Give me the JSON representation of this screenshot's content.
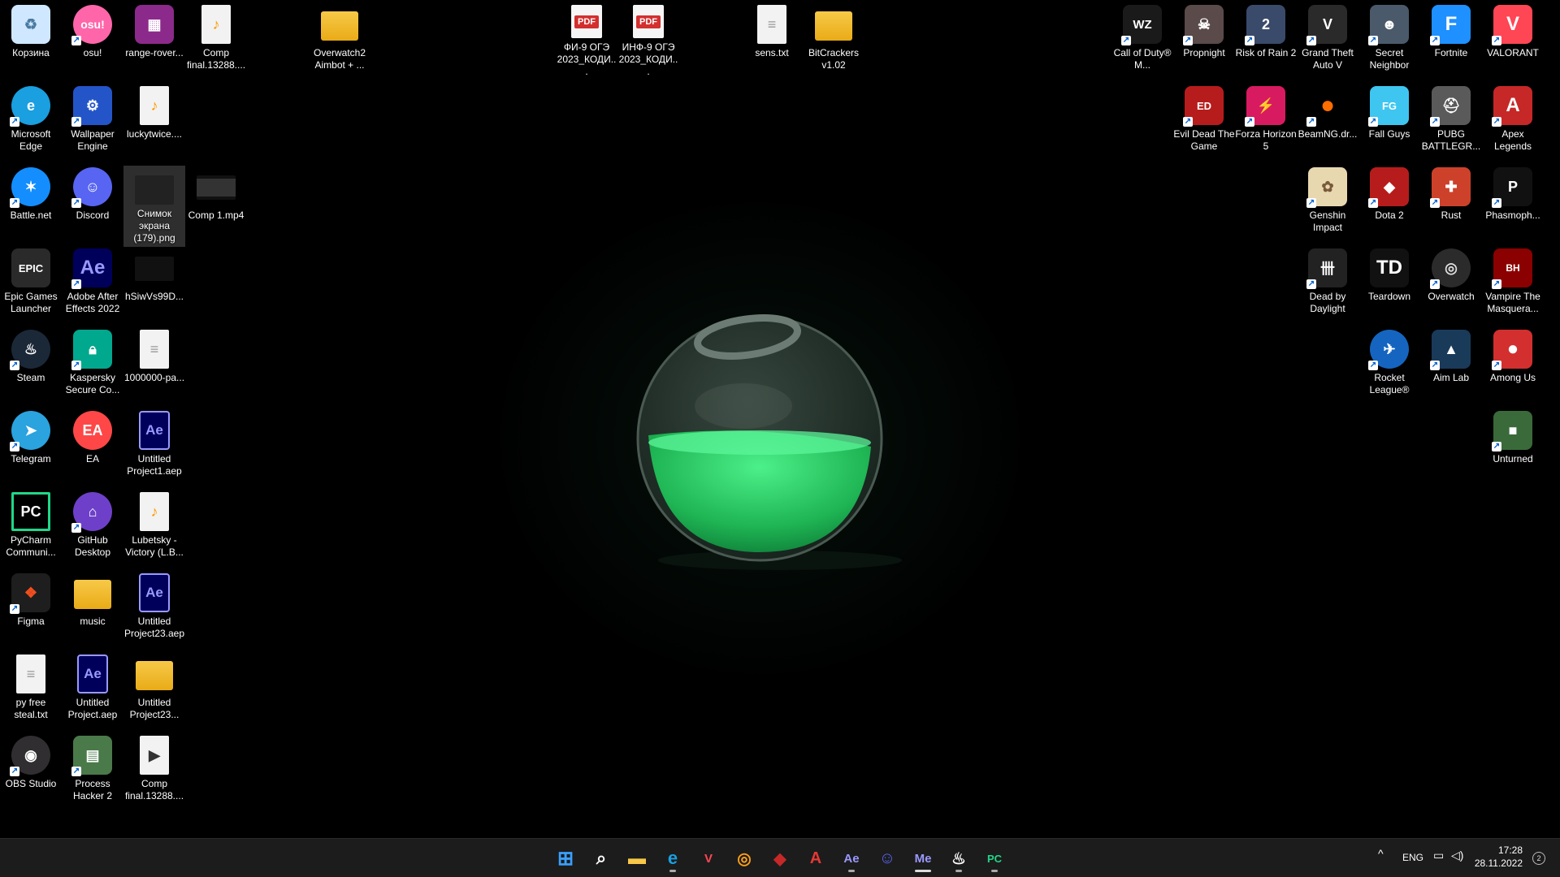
{
  "desktop_icons": {
    "korzina": {
      "label": "Корзина",
      "icon": "recycle-bin-icon",
      "color": "#cfe8ff"
    },
    "osu": {
      "label": "osu!",
      "icon": "osu-icon",
      "color": "#ff66aa"
    },
    "range_rover": {
      "label": "range-rover...",
      "icon": "winrar-archive-icon",
      "color": "#8b2a8b"
    },
    "comp_final_top": {
      "label": "Comp final.13288....",
      "icon": "audio-file-icon",
      "color": "#ffffff"
    },
    "overwatch2_aimbot": {
      "label": "Overwatch2 Aimbot + ...",
      "icon": "folder-icon"
    },
    "fi9": {
      "label": "ФИ-9 ОГЭ 2023_КОДИ...",
      "icon": "pdf-file-icon"
    },
    "inf9": {
      "label": "ИНФ-9 ОГЭ 2023_КОДИ...",
      "icon": "pdf-file-icon"
    },
    "sens": {
      "label": "sens.txt",
      "icon": "text-file-icon"
    },
    "bitcrackers": {
      "label": "BitCrackers v1.02",
      "icon": "folder-icon"
    },
    "edge": {
      "label": "Microsoft Edge",
      "icon": "edge-icon",
      "color": "#1a9fe0"
    },
    "wallpaper_engine": {
      "label": "Wallpaper Engine",
      "icon": "wallpaper-engine-icon",
      "color": "#2455c8"
    },
    "luckytwice": {
      "label": "luckytwice....",
      "icon": "audio-file-icon"
    },
    "battlenet": {
      "label": "Battle.net",
      "icon": "battlenet-icon",
      "color": "#148eff"
    },
    "discord": {
      "label": "Discord",
      "icon": "discord-icon",
      "color": "#5865f2"
    },
    "snimok": {
      "label": "Снимок экрана (179).png",
      "icon": "image-file-icon"
    },
    "comp1": {
      "label": "Comp 1.mp4",
      "icon": "video-file-icon"
    },
    "epic": {
      "label": "Epic Games Launcher",
      "icon": "epic-games-icon",
      "color": "#2a2a2a"
    },
    "after_effects": {
      "label": "Adobe After Effects 2022",
      "icon": "after-effects-icon",
      "color": "#00005b"
    },
    "hsiw": {
      "label": "hSiwVs99D...",
      "icon": "image-file-icon"
    },
    "steam": {
      "label": "Steam",
      "icon": "steam-icon",
      "color": "#1b2838"
    },
    "kaspersky": {
      "label": "Kaspersky Secure Co...",
      "icon": "kaspersky-icon",
      "color": "#00a88e"
    },
    "pa1000000": {
      "label": "1000000-pa...",
      "icon": "text-file-icon"
    },
    "telegram": {
      "label": "Telegram",
      "icon": "telegram-icon",
      "color": "#2aa3df"
    },
    "ea": {
      "label": "EA",
      "icon": "ea-icon",
      "color": "#ff4747"
    },
    "untitled1": {
      "label": "Untitled Project1.aep",
      "icon": "aep-file-icon"
    },
    "pycharm": {
      "label": "PyCharm Communi...",
      "icon": "pycharm-icon",
      "color": "#21d789"
    },
    "github": {
      "label": "GitHub Desktop",
      "icon": "github-icon",
      "color": "#6e40c9"
    },
    "lubetsky": {
      "label": "Lubetsky - Victory (L.B...",
      "icon": "audio-file-icon"
    },
    "figma": {
      "label": "Figma",
      "icon": "figma-icon",
      "color": "#1e1e1e"
    },
    "music": {
      "label": "music",
      "icon": "folder-icon"
    },
    "untitled23": {
      "label": "Untitled Project23.aep",
      "icon": "aep-file-icon"
    },
    "py_free": {
      "label": "py free steal.txt",
      "icon": "text-file-icon"
    },
    "untitled": {
      "label": "Untitled Project.aep",
      "icon": "aep-file-icon"
    },
    "untitled23_folder": {
      "label": "Untitled Project23...",
      "icon": "folder-icon"
    },
    "obs": {
      "label": "OBS Studio",
      "icon": "obs-icon",
      "color": "#302e31"
    },
    "process_hacker": {
      "label": "Process Hacker 2",
      "icon": "process-hacker-icon",
      "color": "#4a7a4a"
    },
    "comp_final_bottom": {
      "label": "Comp final.13288....",
      "icon": "media-file-icon"
    },
    "cod": {
      "label": "Call of Duty® M...",
      "icon": "warzone-icon",
      "color": "#1a1a1a"
    },
    "propnight": {
      "label": "Propnight",
      "icon": "propnight-icon",
      "color": "#5a4a4a"
    },
    "ror2": {
      "label": "Risk of Rain 2",
      "icon": "risk-of-rain-icon",
      "color": "#3a4a6a"
    },
    "gta": {
      "label": "Grand Theft Auto V",
      "icon": "gta-icon",
      "color": "#2a2a2a"
    },
    "secret_neighbor": {
      "label": "Secret Neighbor",
      "icon": "secret-neighbor-icon",
      "color": "#4a5a6a"
    },
    "fortnite": {
      "label": "Fortnite",
      "icon": "fortnite-icon",
      "color": "#1e90ff"
    },
    "valorant": {
      "label": "VALORANT",
      "icon": "valorant-icon",
      "color": "#ff4655"
    },
    "evil_dead": {
      "label": "Evil Dead The Game",
      "icon": "evil-dead-icon",
      "color": "#b71c1c"
    },
    "forza": {
      "label": "Forza Horizon 5",
      "icon": "forza-icon",
      "color": "#d81b60"
    },
    "beamng": {
      "label": "BeamNG.dr...",
      "icon": "beamng-icon",
      "color": "#ff6d00"
    },
    "fall_guys": {
      "label": "Fall Guys",
      "icon": "fall-guys-icon",
      "color": "#3ec6f0"
    },
    "pubg": {
      "label": "PUBG BATTLEGR...",
      "icon": "pubg-icon",
      "color": "#5a5a5a"
    },
    "apex": {
      "label": "Apex Legends",
      "icon": "apex-icon",
      "color": "#c62828"
    },
    "genshin": {
      "label": "Genshin Impact",
      "icon": "genshin-icon",
      "color": "#e8d8b0"
    },
    "dota2": {
      "label": "Dota 2",
      "icon": "dota-icon",
      "color": "#b71c1c"
    },
    "rust": {
      "label": "Rust",
      "icon": "rust-icon",
      "color": "#cd412b"
    },
    "phasmophobia": {
      "label": "Phasmoph...",
      "icon": "phasmophobia-icon",
      "color": "#111111"
    },
    "dbd": {
      "label": "Dead by Daylight",
      "icon": "dead-by-daylight-icon",
      "color": "#222222"
    },
    "teardown": {
      "label": "Teardown",
      "icon": "teardown-icon",
      "color": "#111111"
    },
    "overwatch": {
      "label": "Overwatch",
      "icon": "overwatch-icon",
      "color": "#2b2b2b"
    },
    "vampire": {
      "label": "Vampire The Masquera...",
      "icon": "bloodhunt-icon",
      "color": "#8b0000"
    },
    "rocket_league": {
      "label": "Rocket League®",
      "icon": "rocket-league-icon",
      "color": "#1565c0"
    },
    "aim_lab": {
      "label": "Aim Lab",
      "icon": "aim-lab-icon",
      "color": "#1a3a5a"
    },
    "among_us": {
      "label": "Among Us",
      "icon": "among-us-icon",
      "color": "#d32f2f"
    },
    "unturned": {
      "label": "Unturned",
      "icon": "unturned-icon",
      "color": "#3a6a3a"
    }
  },
  "glyphs": {
    "doc_pdf": "PDF",
    "doc_aep": "Ae",
    "epic": "EPIC",
    "after_effects": "Ae",
    "pycharm": "PC",
    "ea": "EA",
    "teardown": "TD",
    "fortnite": "F",
    "valorant": "V",
    "apex": "A",
    "warzone": "WZ",
    "among_us": "●",
    "discord": "☺",
    "shortcut_arrow": "↗"
  },
  "taskbar": {
    "pinned": [
      {
        "name": "start-button",
        "icon": "windows-logo-icon",
        "glyph": "⊞",
        "color": "#3aa0ff"
      },
      {
        "name": "search-button",
        "icon": "search-icon",
        "glyph": "⌕",
        "color": "#ffffff"
      },
      {
        "name": "file-explorer-button",
        "icon": "folder-icon",
        "glyph": "▬",
        "color": "#f7c948"
      },
      {
        "name": "edge-button",
        "icon": "edge-icon",
        "glyph": "e",
        "color": "#1a9fe0"
      },
      {
        "name": "valorant-button",
        "icon": "valorant-icon",
        "glyph": "V",
        "color": "#ff4655"
      },
      {
        "name": "overwatch-button",
        "icon": "overwatch-icon",
        "glyph": "◎",
        "color": "#f99e1a"
      },
      {
        "name": "dota-button",
        "icon": "dota-icon",
        "glyph": "◆",
        "color": "#c62828"
      },
      {
        "name": "apex-button",
        "icon": "apex-icon",
        "glyph": "A",
        "color": "#e53935"
      },
      {
        "name": "after-effects-button",
        "icon": "after-effects-icon",
        "glyph": "Ae",
        "color": "#9999ff"
      },
      {
        "name": "discord-button",
        "icon": "discord-icon",
        "glyph": "☺",
        "color": "#5865f2"
      },
      {
        "name": "media-encoder-button",
        "icon": "media-encoder-icon",
        "glyph": "Me",
        "color": "#9999ff"
      },
      {
        "name": "steam-button",
        "icon": "steam-icon",
        "glyph": "♨",
        "color": "#ffffff"
      },
      {
        "name": "pycharm-button",
        "icon": "pycharm-icon",
        "glyph": "PC",
        "color": "#21d789"
      }
    ],
    "tray": {
      "chevron": "^",
      "language": "ENG",
      "network_icon": "network-icon",
      "volume_icon": "volume-icon",
      "time": "17:28",
      "date": "28.11.2022",
      "notifications": "2"
    }
  },
  "accent": {
    "potion_green": "#2fd36a"
  }
}
